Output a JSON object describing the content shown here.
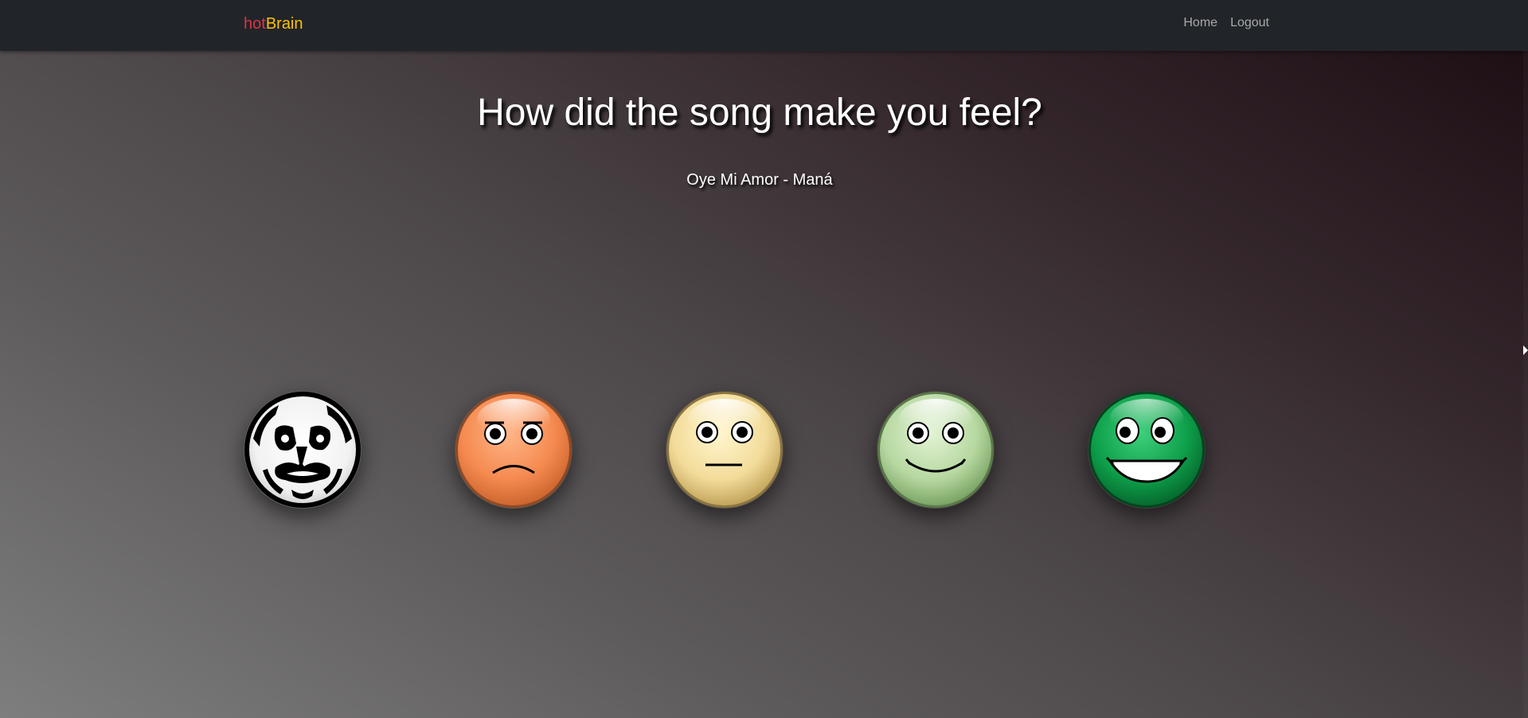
{
  "navbar": {
    "brand_hot": "hot",
    "brand_brain": "Brain",
    "links": [
      {
        "label": "Home"
      },
      {
        "label": "Logout"
      }
    ]
  },
  "main": {
    "title": "How did the song make you feel?",
    "song": "Oye Mi Amor - Maná"
  },
  "faces": [
    {
      "icon": "rage-face-icon",
      "color": "#111111"
    },
    {
      "icon": "sad-face-icon",
      "color": "#f58a50"
    },
    {
      "icon": "neutral-face-icon",
      "color": "#f5e0a0"
    },
    {
      "icon": "happy-face-icon",
      "color": "#b6d8a0"
    },
    {
      "icon": "very-happy-face-icon",
      "color": "#0e9f4a"
    }
  ],
  "colors": {
    "navbar_bg": "#212428",
    "brand_hot": "#dc3545",
    "brand_brain": "#ffc107"
  }
}
